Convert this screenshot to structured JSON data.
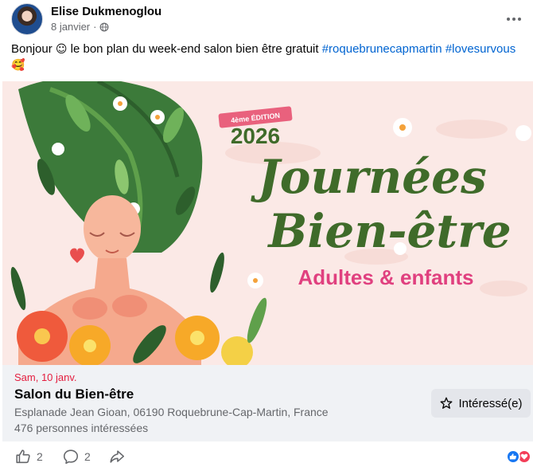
{
  "post": {
    "author": "Elise Dukmenoglou",
    "date": "8 janvier",
    "separator": "·",
    "text_intro": "Bonjour",
    "text_emoji_1": "☺",
    "text_body": " le bon plan du week-end salon bien être gratuit ",
    "hashtag_1": "#roquebrunecapmartin",
    "hashtag_2": "#lovesurvous",
    "text_emoji_2": "🥰"
  },
  "banner": {
    "edition": "4ème ÉDITION",
    "year": "2026",
    "title_line1": "Journées",
    "title_line2": "Bien-être",
    "subtitle": "Adultes & enfants"
  },
  "event": {
    "date": "Sam, 10 janv.",
    "title": "Salon du Bien-être",
    "location": "Esplanade Jean Gioan, 06190 Roquebrune-Cap-Martin, France",
    "interested_count": "476 personnes intéressées",
    "interested_button": "Intéressé(e)"
  },
  "footer": {
    "likes": "2",
    "comments": "2"
  },
  "icons": {
    "more": "more-options-icon",
    "globe": "globe-icon",
    "star": "star-icon",
    "like": "like-icon",
    "comment": "comment-icon",
    "share": "share-icon"
  },
  "colors": {
    "link": "#0064d1",
    "event_date": "#e41e3f",
    "banner_bg": "#fbe9e6",
    "title_green": "#3f6b2a",
    "subtitle_pink": "#e0407f"
  }
}
